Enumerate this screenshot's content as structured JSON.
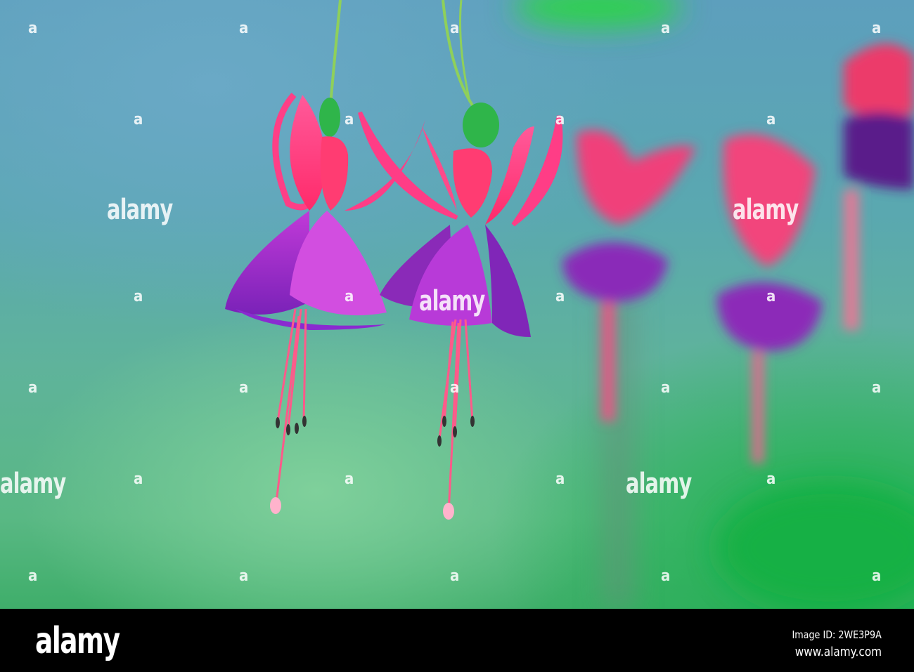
{
  "photo": {
    "subject": "Fuchsia flowers",
    "watermark_text": "alamy",
    "watermark_mark": "a"
  },
  "footer": {
    "logo": "alamy",
    "image_id": "Image ID: 2WE3P9A",
    "website": "www.alamy.com"
  }
}
